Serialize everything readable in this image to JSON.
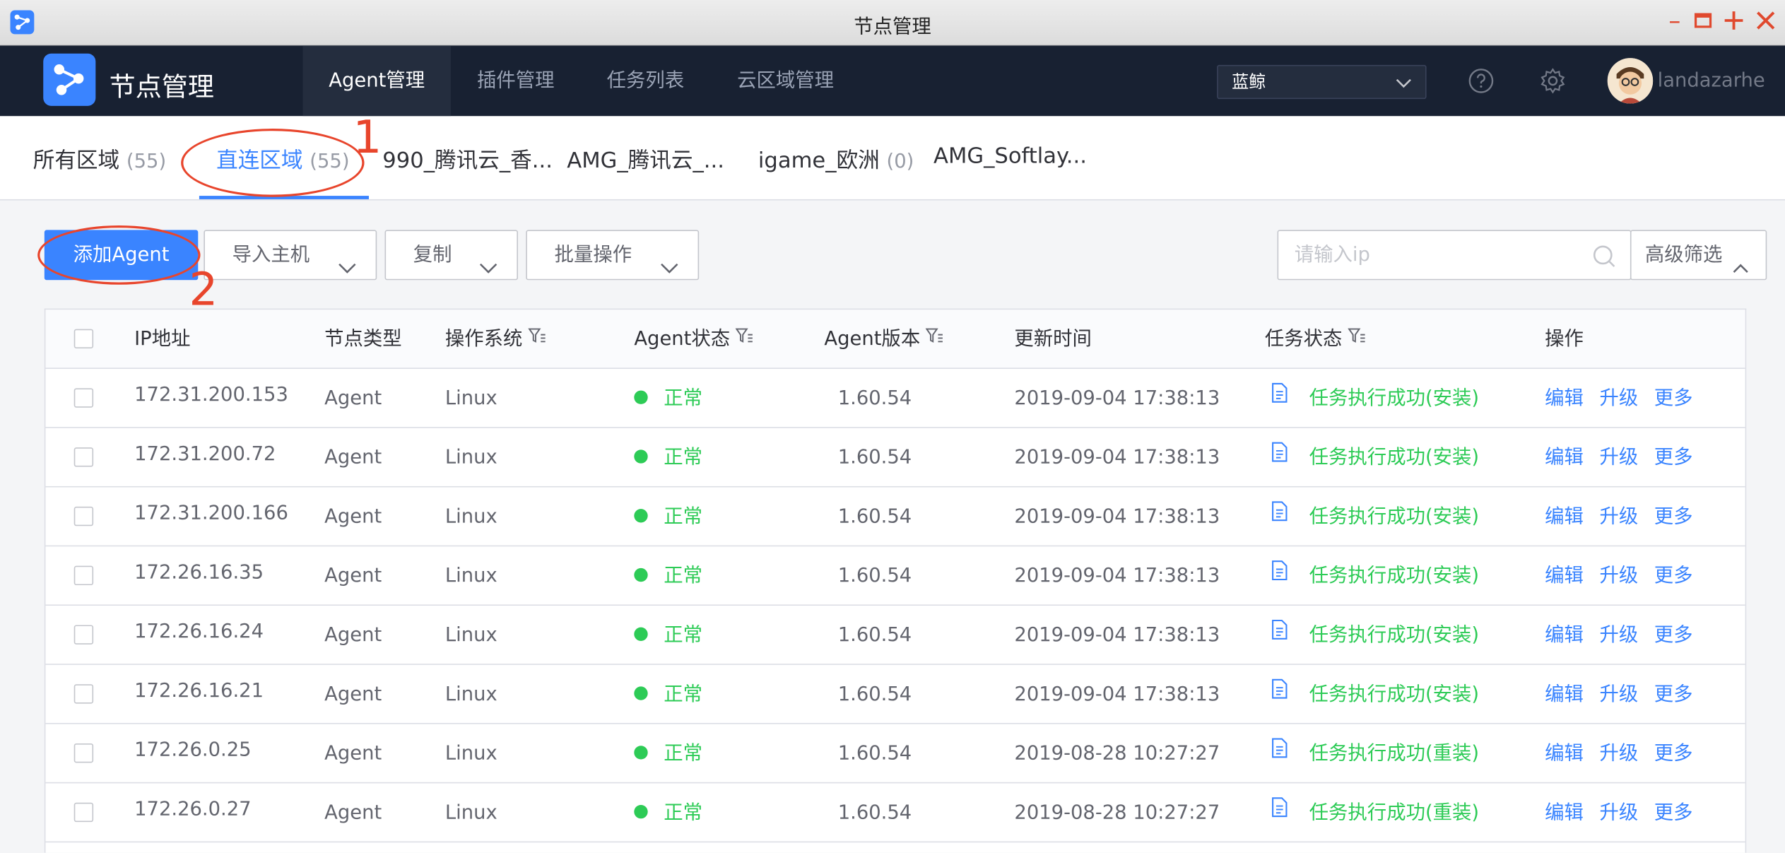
{
  "window": {
    "title": "节点管理"
  },
  "header": {
    "brand": "节点管理",
    "tabs": [
      {
        "label": "Agent管理",
        "active": true
      },
      {
        "label": "插件管理",
        "active": false
      },
      {
        "label": "任务列表",
        "active": false
      },
      {
        "label": "云区域管理",
        "active": false
      }
    ],
    "business": "蓝鲸",
    "username": "landazarhe"
  },
  "regions": [
    {
      "name": "所有区域",
      "count": "(55)",
      "active": false
    },
    {
      "name": "直连区域",
      "count": "(55)",
      "active": true
    },
    {
      "name": "990_腾讯云_香...",
      "count": "",
      "active": false
    },
    {
      "name": "AMG_腾讯云_...",
      "count": "",
      "active": false
    },
    {
      "name": "igame_欧洲",
      "count": "(0)",
      "active": false
    },
    {
      "name": "AMG_Softlay...",
      "count": "",
      "active": false
    }
  ],
  "toolbar": {
    "add_agent": "添加Agent",
    "import_host": "导入主机",
    "copy": "复制",
    "batch": "批量操作",
    "search_placeholder": "请输入ip",
    "advanced_filter": "高级筛选"
  },
  "table": {
    "columns": [
      "IP地址",
      "节点类型",
      "操作系统",
      "Agent状态",
      "Agent版本",
      "更新时间",
      "任务状态",
      "操作"
    ],
    "rows": [
      {
        "ip": "172.31.200.153",
        "type": "Agent",
        "os": "Linux",
        "status": "正常",
        "version": "1.60.54",
        "updated": "2019-09-04 17:38:13",
        "task": "任务执行成功(安装)"
      },
      {
        "ip": "172.31.200.72",
        "type": "Agent",
        "os": "Linux",
        "status": "正常",
        "version": "1.60.54",
        "updated": "2019-09-04 17:38:13",
        "task": "任务执行成功(安装)"
      },
      {
        "ip": "172.31.200.166",
        "type": "Agent",
        "os": "Linux",
        "status": "正常",
        "version": "1.60.54",
        "updated": "2019-09-04 17:38:13",
        "task": "任务执行成功(安装)"
      },
      {
        "ip": "172.26.16.35",
        "type": "Agent",
        "os": "Linux",
        "status": "正常",
        "version": "1.60.54",
        "updated": "2019-09-04 17:38:13",
        "task": "任务执行成功(安装)"
      },
      {
        "ip": "172.26.16.24",
        "type": "Agent",
        "os": "Linux",
        "status": "正常",
        "version": "1.60.54",
        "updated": "2019-09-04 17:38:13",
        "task": "任务执行成功(安装)"
      },
      {
        "ip": "172.26.16.21",
        "type": "Agent",
        "os": "Linux",
        "status": "正常",
        "version": "1.60.54",
        "updated": "2019-09-04 17:38:13",
        "task": "任务执行成功(安装)"
      },
      {
        "ip": "172.26.0.25",
        "type": "Agent",
        "os": "Linux",
        "status": "正常",
        "version": "1.60.54",
        "updated": "2019-08-28 10:27:27",
        "task": "任务执行成功(重装)"
      },
      {
        "ip": "172.26.0.27",
        "type": "Agent",
        "os": "Linux",
        "status": "正常",
        "version": "1.60.54",
        "updated": "2019-08-28 10:27:27",
        "task": "任务执行成功(重装)"
      }
    ],
    "actions": [
      "编辑",
      "升级",
      "更多"
    ]
  },
  "annotations": [
    "1",
    "2"
  ],
  "colors": {
    "primary": "#3a84ff",
    "success": "#2dcb56",
    "nav_bg": "#182132",
    "annotation": "#e8452c"
  }
}
